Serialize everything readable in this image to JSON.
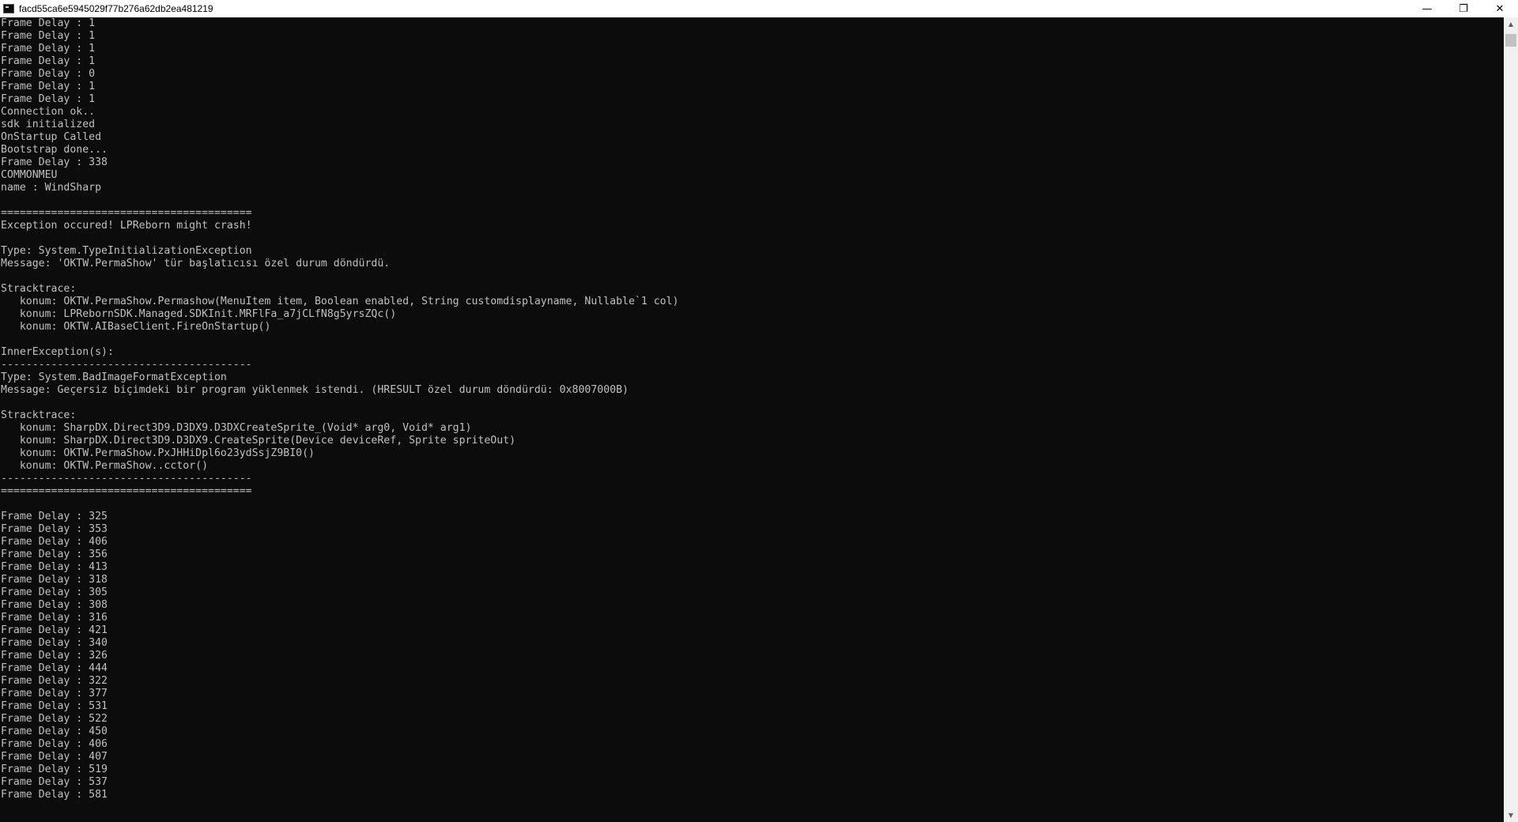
{
  "window": {
    "title": "facd55ca6e5945029f77b276a62db2ea481219",
    "minimize_label": "—",
    "restore_label": "❐",
    "close_label": "✕"
  },
  "scrollbar": {
    "up_arrow": "▲",
    "down_arrow": "▼"
  },
  "console_lines": [
    "Frame Delay : 1",
    "Frame Delay : 1",
    "Frame Delay : 1",
    "Frame Delay : 1",
    "Frame Delay : 0",
    "Frame Delay : 1",
    "Frame Delay : 1",
    "Connection ok..",
    "sdk initialized",
    "OnStartup Called",
    "Bootstrap done...",
    "Frame Delay : 338",
    "COMMONMEU",
    "name : WindSharp",
    "",
    "========================================",
    "Exception occured! LPReborn might crash!",
    "",
    "Type: System.TypeInitializationException",
    "Message: 'OKTW.PermaShow' tür başlatıcısı özel durum döndürdü.",
    "",
    "Stracktrace:",
    "   konum: OKTW.PermaShow.Permashow(MenuItem item, Boolean enabled, String customdisplayname, Nullable`1 col)",
    "   konum: LPRebornSDK.Managed.SDKInit.MRFlFa_a7jCLfN8g5yrsZQc()",
    "   konum: OKTW.AIBaseClient.FireOnStartup()",
    "",
    "InnerException(s):",
    "----------------------------------------",
    "Type: System.BadImageFormatException",
    "Message: Geçersiz biçimdeki bir program yüklenmek istendi. (HRESULT özel durum döndürdü: 0x8007000B)",
    "",
    "Stracktrace:",
    "   konum: SharpDX.Direct3D9.D3DX9.D3DXCreateSprite_(Void* arg0, Void* arg1)",
    "   konum: SharpDX.Direct3D9.D3DX9.CreateSprite(Device deviceRef, Sprite spriteOut)",
    "   konum: OKTW.PermaShow.PxJHHiDpl6o23ydSsjZ9BI0()",
    "   konum: OKTW.PermaShow..cctor()",
    "----------------------------------------",
    "========================================",
    "",
    "Frame Delay : 325",
    "Frame Delay : 353",
    "Frame Delay : 406",
    "Frame Delay : 356",
    "Frame Delay : 413",
    "Frame Delay : 318",
    "Frame Delay : 305",
    "Frame Delay : 308",
    "Frame Delay : 316",
    "Frame Delay : 421",
    "Frame Delay : 340",
    "Frame Delay : 326",
    "Frame Delay : 444",
    "Frame Delay : 322",
    "Frame Delay : 377",
    "Frame Delay : 531",
    "Frame Delay : 522",
    "Frame Delay : 450",
    "Frame Delay : 406",
    "Frame Delay : 407",
    "Frame Delay : 519",
    "Frame Delay : 537",
    "Frame Delay : 581"
  ]
}
